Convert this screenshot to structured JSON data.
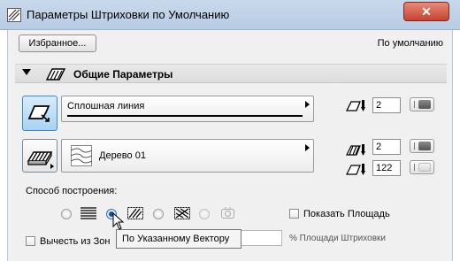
{
  "window": {
    "title": "Параметры Штриховки по Умолчанию",
    "close_symbol": "✕"
  },
  "toolbar": {
    "favorites_label": "Избранное...",
    "default_label": "По умолчанию"
  },
  "section": {
    "title": "Общие Параметры"
  },
  "contour": {
    "linetype": "Сплошная линия",
    "pen_value": "2"
  },
  "fill": {
    "pattern": "Дерево 01",
    "fg_pen_value": "2",
    "bg_pen_value": "122"
  },
  "build_method": {
    "label": "Способ построения:",
    "options": [
      "uniform",
      "along-vector",
      "rotated",
      "radial"
    ],
    "selected_index": 1
  },
  "show_area": {
    "label": "Показать Площадь",
    "checked": false
  },
  "subtract_zones": {
    "label": "Вычесть из Зон",
    "checked": false
  },
  "tooltip": {
    "text": "По Указанному Вектору"
  },
  "area_percent": {
    "label": "% Площади Штриховки",
    "value": ""
  }
}
